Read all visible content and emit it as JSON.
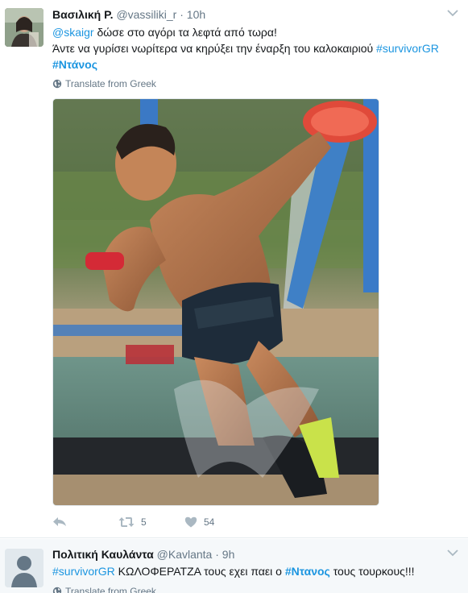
{
  "tweets": [
    {
      "name": "Βασιλική Ρ.",
      "handle": "@vassiliki_r",
      "dot": "·",
      "time": "10h",
      "line1_mention": "@skaigr",
      "line1_text": " δώσε στο αγόρι τα λεφτά από τωρα!",
      "line2_text": "Άντε να γυρίσει νωρίτερα να κηρύξει την έναρξη του καλοκαιριού ",
      "line2_hashtag": "#survivorGR",
      "line3_hashtag": "#Ντάνος",
      "translate": "Translate from Greek",
      "retweets": "5",
      "likes": "54"
    },
    {
      "name": "Πολιτική Καυλάντα",
      "handle": "@Kavlanta",
      "dot": "·",
      "time": "9h",
      "hashtag1": "#survivorGR",
      "text_mid": " ΚΩΛΟΦΕΡΑΤΖΑ τους εχει παει ο ",
      "hashtag2": "#Ντανος",
      "text_end": " τους τουρκους!!!",
      "translate": "Translate from Greek"
    }
  ],
  "icons": {
    "caret": "chevron-down-icon",
    "globe": "globe-icon",
    "reply": "reply-icon",
    "retweet": "retweet-icon",
    "like": "heart-icon",
    "default_avatar": "default-avatar-icon"
  },
  "colors": {
    "link": "#1b95e0",
    "secondary": "#657786",
    "text": "#14171a",
    "divider": "#e6ecf0",
    "secondary_bg": "#f5f8fa"
  }
}
